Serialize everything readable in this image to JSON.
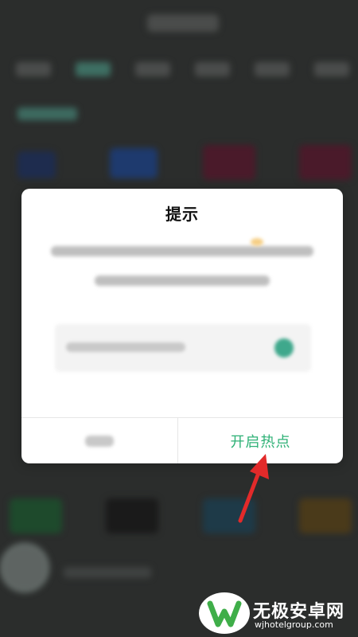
{
  "dialog": {
    "title": "提示",
    "confirm_button": "开启热点"
  },
  "watermark": {
    "title": "无极安卓网",
    "url": "wjhotelgroup.com"
  },
  "colors": {
    "accent_green": "#2eb176",
    "arrow_red": "#e22a2a",
    "overlay": "#2b2d2c"
  }
}
